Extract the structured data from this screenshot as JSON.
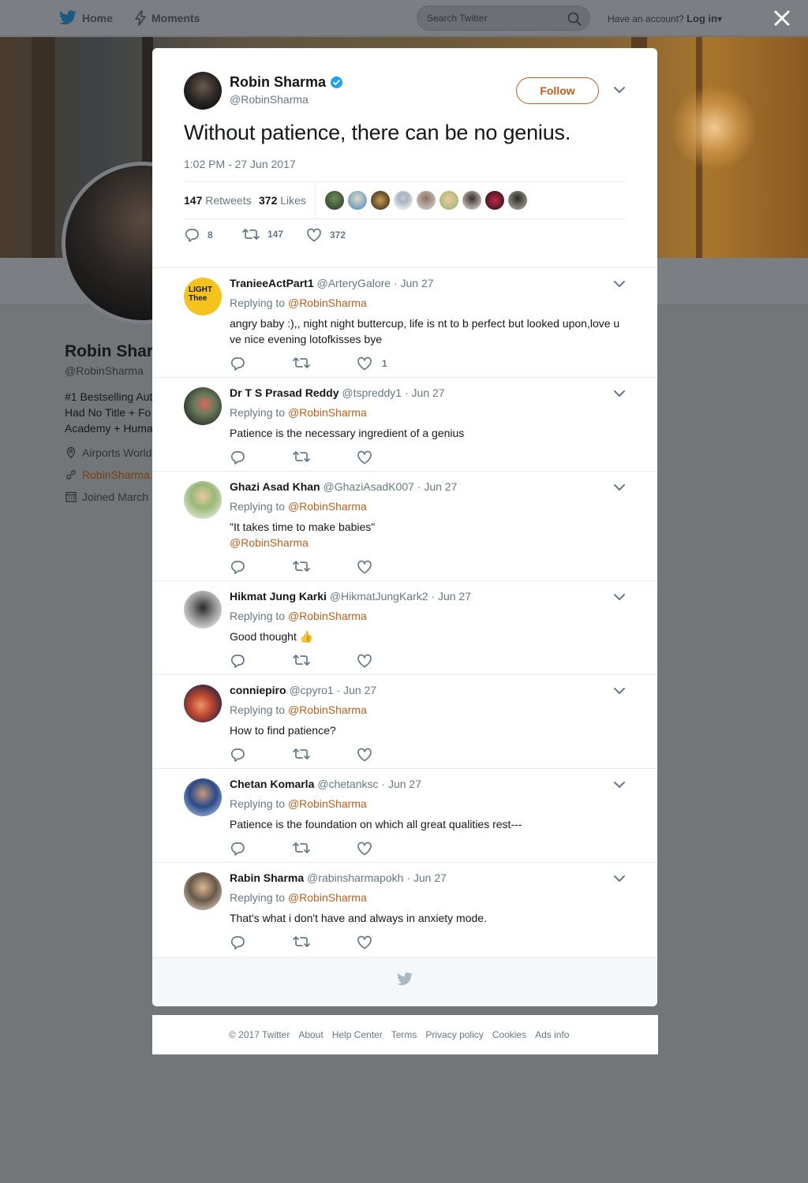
{
  "nav": {
    "home_label": "Home",
    "moments_label": "Moments",
    "search_placeholder": "Search Twitter",
    "have_account": "Have an account?",
    "login_label": "Log in"
  },
  "profile_bg": {
    "name": "Robin Shar",
    "handle": "@RobinSharma",
    "bio_lines": [
      "#1 Bestselling Aut",
      "Had No Title + Fo",
      "Academy + Huma"
    ],
    "location": "Airports World",
    "website": "RobinSharma.",
    "joined": "Joined March"
  },
  "tweet": {
    "author_name": "Robin Sharma",
    "author_handle": "@RobinSharma",
    "follow_label": "Follow",
    "text": "Without patience, there can be no genius.",
    "timestamp": "1:02 PM - 27 Jun 2017",
    "retweets_count": "147",
    "retweets_label": "Retweets",
    "likes_count": "372",
    "likes_label": "Likes",
    "reply_count": "8",
    "retweet_count_action": "147",
    "like_count_action": "372"
  },
  "replies": [
    {
      "name": "TranieeActPart1",
      "handle": "@ArteryGalore",
      "date": "· Jun 27",
      "replying_prefix": "Replying to",
      "replying_to": "@RobinSharma",
      "text": "angry baby :),, night night buttercup, life is nt to b perfect but looked upon,love u ve nice evening lotofkisses bye",
      "mention": "",
      "like_count": "1",
      "avatar_text_1": "LIGHT",
      "avatar_text_2": "Thee"
    },
    {
      "name": "Dr T S Prasad Reddy",
      "handle": "@tspreddy1",
      "date": "· Jun 27",
      "replying_prefix": "Replying to",
      "replying_to": "@RobinSharma",
      "text": "Patience is the necessary ingredient of a genius",
      "mention": "",
      "like_count": ""
    },
    {
      "name": "Ghazi Asad Khan",
      "handle": "@GhaziAsadK007",
      "date": "· Jun 27",
      "replying_prefix": "Replying to",
      "replying_to": "@RobinSharma",
      "text": "\"It takes time to make babies\"",
      "mention": "@RobinSharma",
      "like_count": ""
    },
    {
      "name": "Hikmat Jung Karki",
      "handle": "@HikmatJungKark2",
      "date": "· Jun 27",
      "replying_prefix": "Replying to",
      "replying_to": "@RobinSharma",
      "text": "Good thought 👍",
      "mention": "",
      "like_count": ""
    },
    {
      "name": "conniepiro",
      "handle": "@cpyro1",
      "date": "· Jun 27",
      "replying_prefix": "Replying to",
      "replying_to": "@RobinSharma",
      "text": "How to find patience?",
      "mention": "",
      "like_count": ""
    },
    {
      "name": "Chetan Komarla",
      "handle": "@chetanksc",
      "date": "· Jun 27",
      "replying_prefix": "Replying to",
      "replying_to": "@RobinSharma",
      "text": "Patience is the foundation on which all great qualities rest---",
      "mention": "",
      "like_count": ""
    },
    {
      "name": "Rabin Sharma",
      "handle": "@rabinsharmapokh",
      "date": "· Jun 27",
      "replying_prefix": "Replying to",
      "replying_to": "@RobinSharma",
      "text": "That's what i don't have and always in anxiety mode.",
      "mention": "",
      "like_count": ""
    }
  ],
  "footer": {
    "links": [
      "© 2017 Twitter",
      "About",
      "Help Center",
      "Terms",
      "Privacy policy",
      "Cookies",
      "Ads info"
    ]
  },
  "colors": {
    "accent": "#c45d19",
    "verified": "#1da1f2",
    "secondary_text": "#657786",
    "overlay": "#737679"
  },
  "icons": {
    "bird": "twitter-bird-icon",
    "moments": "lightning-icon",
    "search": "search-icon",
    "close": "close-icon",
    "verified": "verified-badge-icon",
    "caret": "chevron-down-icon",
    "reply": "reply-icon",
    "retweet": "retweet-icon",
    "like": "heart-icon"
  }
}
